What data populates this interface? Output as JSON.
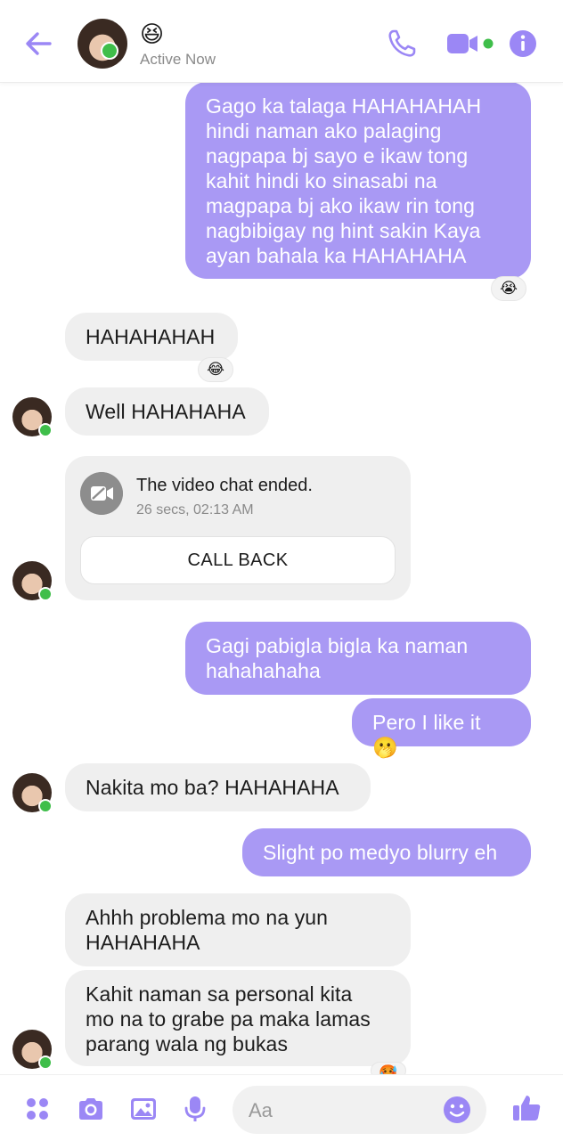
{
  "header": {
    "name_emoji": "😆",
    "status": "Active Now"
  },
  "messages": [
    {
      "id": "m1",
      "side": "out",
      "text": "Gago ka talaga HAHAHAHAH\nhindi naman ako palaging\nnagpapa bj sayo e ikaw tong\nkahit hindi ko sinasabi na\nmagpapa bj ako ikaw rin tong\nnagbibigay ng hint sakin Kaya\nayan bahala ka HAHAHAHA",
      "reaction": "😭"
    },
    {
      "id": "m2",
      "side": "in",
      "text": "HAHAHAHAH",
      "reaction": "😂"
    },
    {
      "id": "m3",
      "side": "in",
      "text": "Well HAHAHAHA"
    },
    {
      "id": "m5",
      "side": "out",
      "text": "Gagi pabigla bigla ka naman\nhahahahaha"
    },
    {
      "id": "m6",
      "side": "out",
      "text": "Pero I like it 🫢"
    },
    {
      "id": "m7",
      "side": "in",
      "text": "Nakita mo ba? HAHAHAHA"
    },
    {
      "id": "m8",
      "side": "out",
      "text": "Slight po medyo blurry eh"
    },
    {
      "id": "m9",
      "side": "in",
      "text": "Ahhh problema mo na yun\nHAHAHAHA"
    },
    {
      "id": "m10",
      "side": "in",
      "text": "Kahit naman sa personal kita\nmo na to grabe pa maka lamas\nparang wala ng bukas",
      "reaction": "🥵"
    }
  ],
  "video_card": {
    "title": "The video chat ended.",
    "subtitle": "26 secs, 02:13 AM",
    "button": "CALL BACK"
  },
  "composer": {
    "placeholder": "Aa"
  },
  "colors": {
    "accent": "#9b87f5",
    "outgoing_bubble": "#a999f4",
    "incoming_bubble": "#efefef",
    "online": "#3fbe4a"
  }
}
